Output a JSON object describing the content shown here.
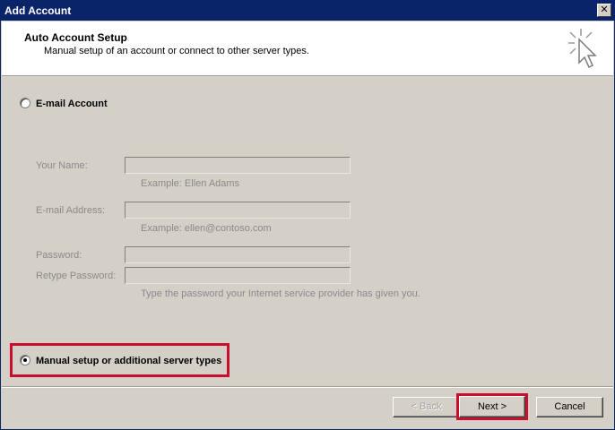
{
  "window": {
    "title": "Add Account",
    "close_glyph": "✕"
  },
  "header": {
    "title": "Auto Account Setup",
    "subtitle": "Manual setup of an account or connect to other server types.",
    "icon": "cursor-click-icon"
  },
  "email_option": {
    "label": "E-mail Account",
    "selected": false
  },
  "fields": {
    "name": {
      "label": "Your Name:",
      "value": "",
      "hint": "Example: Ellen Adams"
    },
    "email": {
      "label": "E-mail Address:",
      "value": "",
      "hint": "Example: ellen@contoso.com"
    },
    "password": {
      "label": "Password:",
      "value": ""
    },
    "retype": {
      "label": "Retype Password:",
      "value": "",
      "hint": "Type the password your Internet service provider has given you."
    }
  },
  "manual_option": {
    "label": "Manual setup or additional server types",
    "selected": true
  },
  "buttons": {
    "back": "< Back",
    "next": "Next >",
    "cancel": "Cancel"
  },
  "colors": {
    "highlight": "#c8102e",
    "titlebar": "#0a246a"
  }
}
